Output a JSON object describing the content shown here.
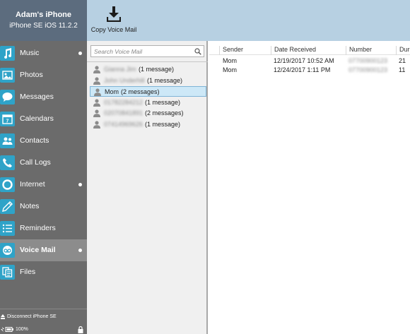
{
  "device": {
    "name": "Adam's iPhone",
    "info": "iPhone SE iOS 11.2.2"
  },
  "nav": [
    {
      "label": "Music",
      "icon": "music-icon",
      "dot": true,
      "active": false
    },
    {
      "label": "Photos",
      "icon": "photos-icon",
      "dot": false,
      "active": false
    },
    {
      "label": "Messages",
      "icon": "messages-icon",
      "dot": false,
      "active": false
    },
    {
      "label": "Calendars",
      "icon": "calendar-icon",
      "dot": false,
      "active": false
    },
    {
      "label": "Contacts",
      "icon": "contacts-icon",
      "dot": false,
      "active": false
    },
    {
      "label": "Call Logs",
      "icon": "phone-icon",
      "dot": false,
      "active": false
    },
    {
      "label": "Internet",
      "icon": "internet-icon",
      "dot": true,
      "active": false
    },
    {
      "label": "Notes",
      "icon": "pencil-icon",
      "dot": false,
      "active": false
    },
    {
      "label": "Reminders",
      "icon": "list-icon",
      "dot": false,
      "active": false
    },
    {
      "label": "Voice Mail",
      "icon": "voicemail-icon",
      "dot": true,
      "active": true
    },
    {
      "label": "Files",
      "icon": "files-icon",
      "dot": false,
      "active": false
    }
  ],
  "footer": {
    "disconnect_label": "Disconnect iPhone SE",
    "battery": "100%"
  },
  "toolbar": {
    "copy_label": "Copy Voice Mail"
  },
  "search": {
    "placeholder": "Search Voice Mail"
  },
  "contacts": [
    {
      "name": "Gianna Jim",
      "count": "(1 message)",
      "blurred": true,
      "selected": false
    },
    {
      "name": "John Underhill",
      "count": "(1 message)",
      "blurred": true,
      "selected": false
    },
    {
      "name": "Mom",
      "count": "(2 messages)",
      "blurred": false,
      "selected": true
    },
    {
      "name": "01782284212",
      "count": "(1 message)",
      "blurred": true,
      "selected": false
    },
    {
      "name": "02070841891",
      "count": "(2 messages)",
      "blurred": true,
      "selected": false
    },
    {
      "name": "07414969626",
      "count": "(1 message)",
      "blurred": true,
      "selected": false
    }
  ],
  "table": {
    "columns": [
      "Sender",
      "Date Received",
      "Number",
      "Dur"
    ],
    "rows": [
      {
        "sender": "Mom",
        "date": "12/19/2017 10:52 AM",
        "number": "07700900123",
        "duration": "21"
      },
      {
        "sender": "Mom",
        "date": "12/24/2017 1:11 PM",
        "number": "07700900123",
        "duration": "11"
      }
    ]
  },
  "colors": {
    "accent": "#2fa3c8",
    "sidebar": "#6b6b6b",
    "device_header": "#5c6c7e",
    "toolbar": "#b7d0e2",
    "selection": "#cde8f7"
  }
}
